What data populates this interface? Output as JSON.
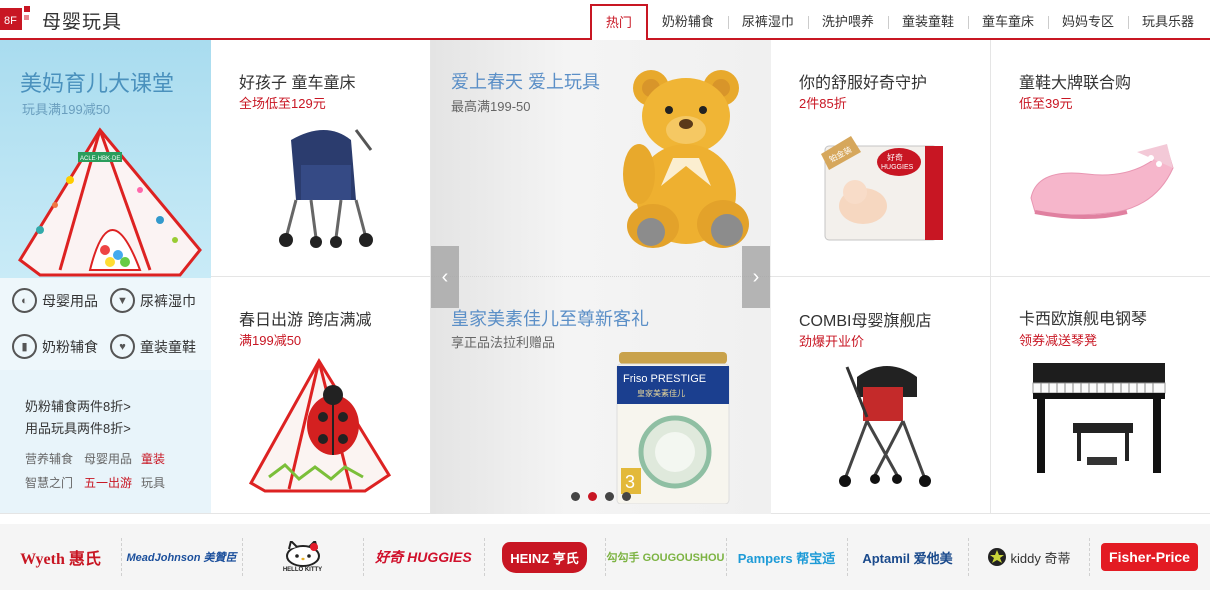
{
  "floor": {
    "badge": "8F",
    "title": "母婴玩具"
  },
  "tabs": [
    "热门",
    "奶粉辅食",
    "尿裤湿巾",
    "洗护喂养",
    "童装童鞋",
    "童车童床",
    "妈妈专区",
    "玩具乐器"
  ],
  "left": {
    "promo_title": "美妈育儿大课堂",
    "promo_sub": "玩具满199减50",
    "tent_label": "ACLE·HBK·DE",
    "quick_cats": [
      "母婴用品",
      "尿裤湿巾",
      "奶粉辅食",
      "童装童鞋"
    ],
    "promo_links": [
      "奶粉辅食两件8折>",
      "用品玩具两件8折>"
    ],
    "tags": [
      "营养辅食",
      "母婴用品",
      "童装",
      "智慧之门",
      "五一出游",
      "玩具"
    ]
  },
  "cells": {
    "stroller": {
      "title": "好孩子 童车童床",
      "sub": "全场低至129元"
    },
    "diaper": {
      "title": "你的舒服好奇守护",
      "sub": "2件85折",
      "badge": "铂金装",
      "brand": "好奇",
      "brand_en": "HUGGIES"
    },
    "shoes": {
      "title": "童鞋大牌联合购",
      "sub": "低至39元"
    },
    "tent": {
      "title": "春日出游 跨店满减",
      "sub": "满199减50"
    },
    "combi": {
      "title": "COMBI母婴旗舰店",
      "sub": "劲爆开业价"
    },
    "piano": {
      "title": "卡西欧旗舰电钢琴",
      "sub": "领券减送琴凳"
    }
  },
  "carousel": {
    "slide1_title": "爱上春天  爱上玩具",
    "slide1_sub": "最高满199-50",
    "slide2_title": "皇家美素佳儿至尊新客礼",
    "slide2_sub": "享正品法拉利赠品",
    "can_brand": "Friso PRESTIGE",
    "can_cn": "皇家美素佳儿",
    "can_stage": "3",
    "prev": "‹",
    "next": "›",
    "dot_count": 4,
    "active_dot": 1
  },
  "brands": [
    {
      "name": "Wyeth 惠氏",
      "color": "#c81623"
    },
    {
      "name": "MeadJohnson 美贊臣",
      "color": "#1b4f9c"
    },
    {
      "name": "HELLO KITTY",
      "color": "#222222"
    },
    {
      "name": "好奇 HUGGIES",
      "color": "#d0102b"
    },
    {
      "name": "HEINZ 亨氏",
      "color": "#c81623"
    },
    {
      "name": "勾勾手 GOUGOUSHOU",
      "color": "#7cb342"
    },
    {
      "name": "Pampers 帮宝适",
      "color": "#1e9bd7"
    },
    {
      "name": "Aptamil 爱他美",
      "color": "#1a4a8c"
    },
    {
      "name": "kiddy 奇蒂",
      "color": "#333333"
    },
    {
      "name": "Fisher-Price",
      "color": "#e31b23"
    }
  ]
}
